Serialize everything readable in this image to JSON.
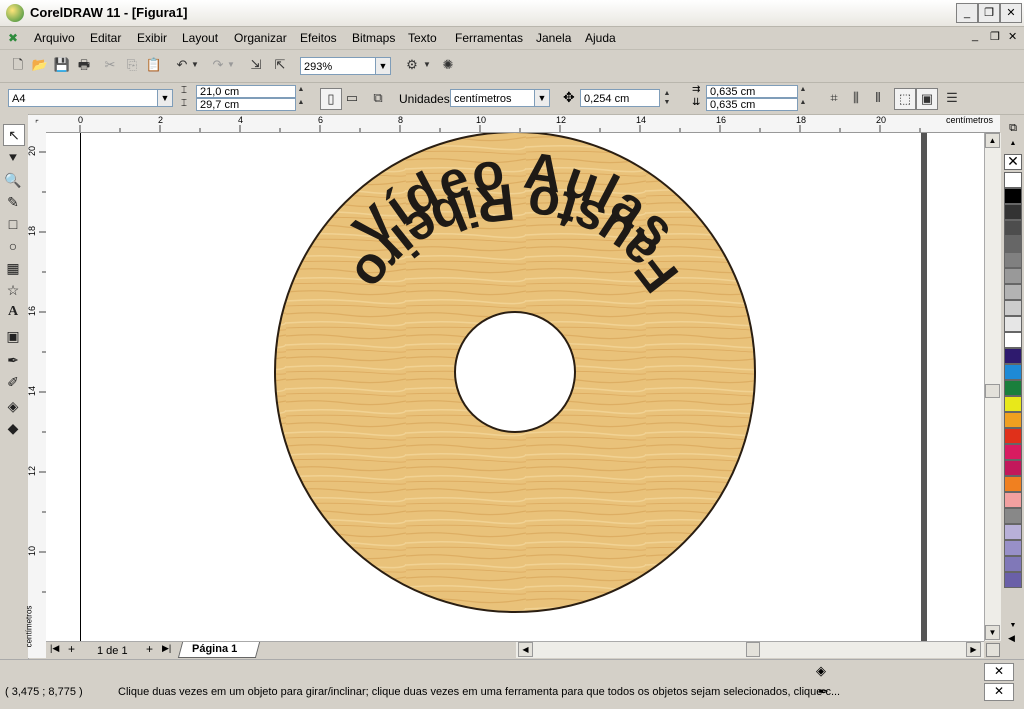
{
  "window": {
    "title": "CorelDRAW 11 - [Figura1]"
  },
  "menu": [
    "Arquivo",
    "Editar",
    "Exibir",
    "Layout",
    "Organizar",
    "Efeitos",
    "Bitmaps",
    "Texto",
    "Ferramentas",
    "Janela",
    "Ajuda"
  ],
  "toolbar": {
    "zoom": "293%"
  },
  "property_bar": {
    "paper_size": "A4",
    "width": "21,0 cm",
    "height": "29,7 cm",
    "units_label": "Unidades:",
    "units": "centímetros",
    "nudge": "0,254 cm",
    "dup_x": "0,635 cm",
    "dup_y": "0,635 cm"
  },
  "ruler": {
    "h_ticks": [
      "0",
      "2",
      "4",
      "6",
      "8",
      "10",
      "12",
      "14",
      "16",
      "18",
      "20"
    ],
    "h_unit": "centímetros",
    "v_ticks": [
      "20",
      "18",
      "16",
      "14",
      "12",
      "10"
    ],
    "v_unit": "centímetros"
  },
  "artwork": {
    "top_text": "Vídeo Aulas",
    "bottom_text": "Fausto Ribeiro",
    "disc_color": "#e9c27a"
  },
  "page_nav": {
    "count": "1 de 1",
    "tab": "Página 1"
  },
  "status": {
    "coords": "( 3,475 ; 8,775 )",
    "hint": "Clique duas vezes em um objeto para girar/inclinar; clique duas vezes em uma ferramenta para que todos os objetos sejam selecionados, clique c..."
  },
  "palette": [
    "#ffffff",
    "#000000",
    "#333333",
    "#4d4d4d",
    "#666666",
    "#808080",
    "#999999",
    "#b3b3b3",
    "#cccccc",
    "#e6e6e6",
    "#ffffff",
    "#2e1a6e",
    "#1e8ad6",
    "#1a7f3c",
    "#e8e81a",
    "#f0a020",
    "#e0301a",
    "#d81b60",
    "#c2185b",
    "#f08020",
    "#f2a0a0",
    "#888888",
    "#b8b0d8",
    "#9890c8",
    "#8078b8",
    "#6a60a8"
  ]
}
